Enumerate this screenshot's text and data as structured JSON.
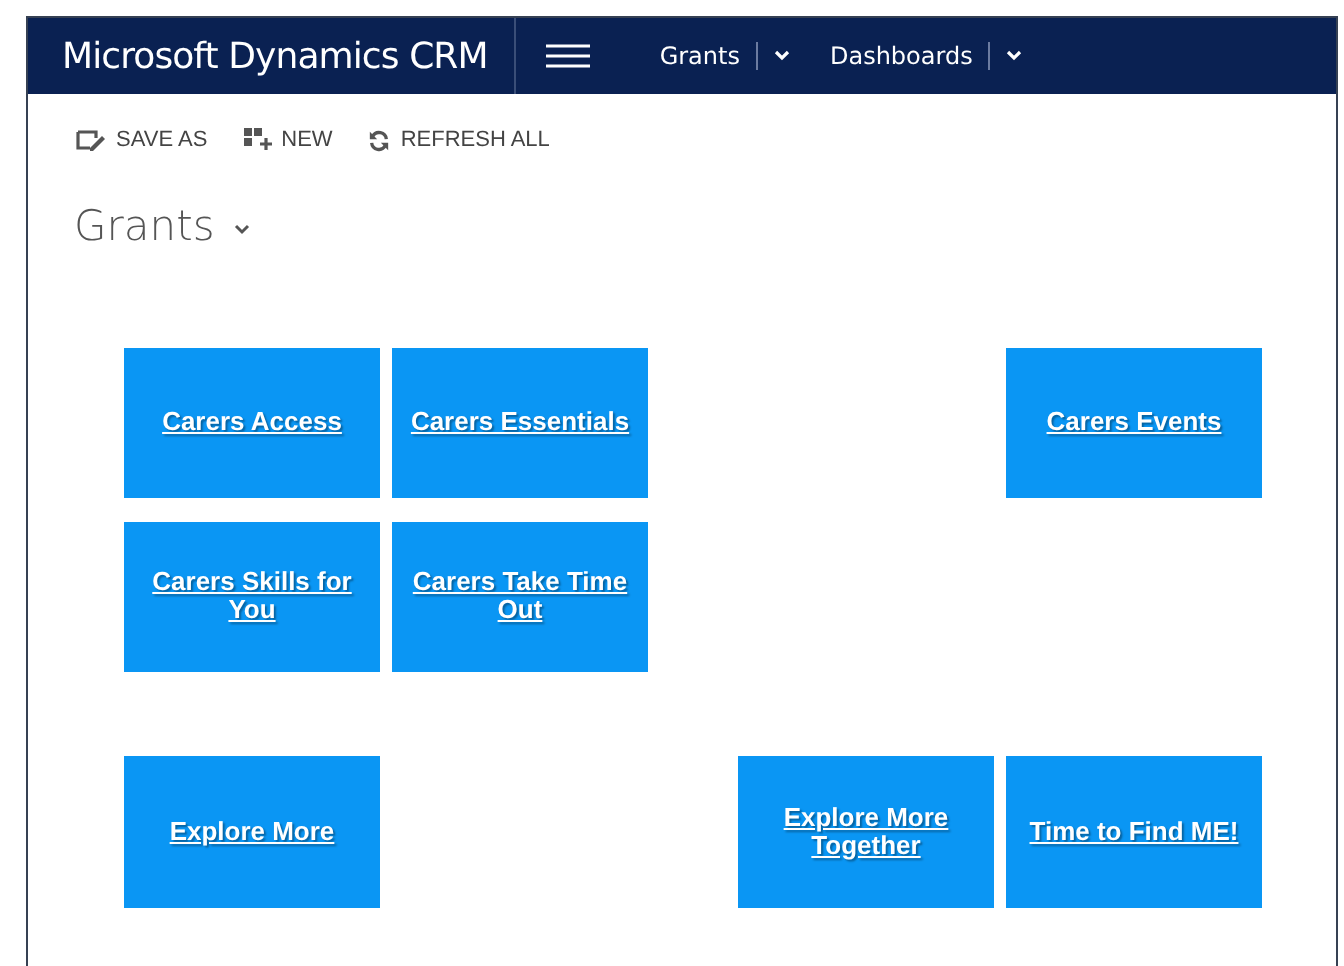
{
  "header": {
    "title": "Microsoft Dynamics CRM",
    "nav": [
      {
        "label": "Grants"
      },
      {
        "label": "Dashboards"
      }
    ]
  },
  "toolbar": [
    {
      "kind": "save",
      "label": "SAVE AS"
    },
    {
      "kind": "new",
      "label": "NEW"
    },
    {
      "kind": "refresh",
      "label": "REFRESH ALL"
    }
  ],
  "dashboard": {
    "title": "Grants"
  },
  "tile_rows": [
    [
      {
        "kind": "tile",
        "label": "Carers Access"
      },
      {
        "kind": "tile",
        "label": "Carers Essentials"
      },
      {
        "kind": "blank"
      },
      {
        "kind": "blank"
      },
      {
        "kind": "tile",
        "label": "Carers Events"
      }
    ],
    [
      {
        "kind": "tile",
        "label": "Carers Skills for You"
      },
      {
        "kind": "tile",
        "label": "Carers Take Time Out"
      },
      {
        "kind": "blank"
      },
      {
        "kind": "blank"
      },
      {
        "kind": "blank"
      }
    ],
    [
      {
        "kind": "tile",
        "label": "Explore More"
      },
      {
        "kind": "blank"
      },
      {
        "kind": "blank"
      },
      {
        "kind": "tile",
        "label": "Explore More Together"
      },
      {
        "kind": "tile",
        "label": "Time to Find ME!"
      }
    ]
  ]
}
